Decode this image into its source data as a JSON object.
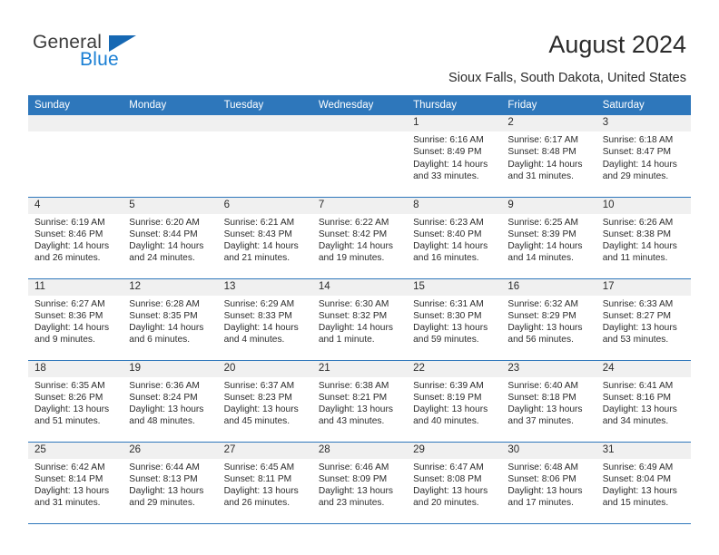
{
  "brand": {
    "name_part1": "General",
    "name_part2": "Blue",
    "logo_icon": "triangle-flag-icon",
    "accent_color": "#1a7fd4",
    "triangle_color": "#1668b3"
  },
  "header": {
    "title": "August 2024",
    "location": "Sioux Falls, South Dakota, United States"
  },
  "calendar": {
    "header_bg": "#2e77bb",
    "header_text_color": "#ffffff",
    "daynum_band_bg": "#f0f0f0",
    "weekday_headers": [
      "Sunday",
      "Monday",
      "Tuesday",
      "Wednesday",
      "Thursday",
      "Friday",
      "Saturday"
    ],
    "weeks": [
      [
        {
          "day": "",
          "sunrise": "",
          "sunset": "",
          "daylight_line1": "",
          "daylight_line2": ""
        },
        {
          "day": "",
          "sunrise": "",
          "sunset": "",
          "daylight_line1": "",
          "daylight_line2": ""
        },
        {
          "day": "",
          "sunrise": "",
          "sunset": "",
          "daylight_line1": "",
          "daylight_line2": ""
        },
        {
          "day": "",
          "sunrise": "",
          "sunset": "",
          "daylight_line1": "",
          "daylight_line2": ""
        },
        {
          "day": "1",
          "sunrise": "Sunrise: 6:16 AM",
          "sunset": "Sunset: 8:49 PM",
          "daylight_line1": "Daylight: 14 hours",
          "daylight_line2": "and 33 minutes."
        },
        {
          "day": "2",
          "sunrise": "Sunrise: 6:17 AM",
          "sunset": "Sunset: 8:48 PM",
          "daylight_line1": "Daylight: 14 hours",
          "daylight_line2": "and 31 minutes."
        },
        {
          "day": "3",
          "sunrise": "Sunrise: 6:18 AM",
          "sunset": "Sunset: 8:47 PM",
          "daylight_line1": "Daylight: 14 hours",
          "daylight_line2": "and 29 minutes."
        }
      ],
      [
        {
          "day": "4",
          "sunrise": "Sunrise: 6:19 AM",
          "sunset": "Sunset: 8:46 PM",
          "daylight_line1": "Daylight: 14 hours",
          "daylight_line2": "and 26 minutes."
        },
        {
          "day": "5",
          "sunrise": "Sunrise: 6:20 AM",
          "sunset": "Sunset: 8:44 PM",
          "daylight_line1": "Daylight: 14 hours",
          "daylight_line2": "and 24 minutes."
        },
        {
          "day": "6",
          "sunrise": "Sunrise: 6:21 AM",
          "sunset": "Sunset: 8:43 PM",
          "daylight_line1": "Daylight: 14 hours",
          "daylight_line2": "and 21 minutes."
        },
        {
          "day": "7",
          "sunrise": "Sunrise: 6:22 AM",
          "sunset": "Sunset: 8:42 PM",
          "daylight_line1": "Daylight: 14 hours",
          "daylight_line2": "and 19 minutes."
        },
        {
          "day": "8",
          "sunrise": "Sunrise: 6:23 AM",
          "sunset": "Sunset: 8:40 PM",
          "daylight_line1": "Daylight: 14 hours",
          "daylight_line2": "and 16 minutes."
        },
        {
          "day": "9",
          "sunrise": "Sunrise: 6:25 AM",
          "sunset": "Sunset: 8:39 PM",
          "daylight_line1": "Daylight: 14 hours",
          "daylight_line2": "and 14 minutes."
        },
        {
          "day": "10",
          "sunrise": "Sunrise: 6:26 AM",
          "sunset": "Sunset: 8:38 PM",
          "daylight_line1": "Daylight: 14 hours",
          "daylight_line2": "and 11 minutes."
        }
      ],
      [
        {
          "day": "11",
          "sunrise": "Sunrise: 6:27 AM",
          "sunset": "Sunset: 8:36 PM",
          "daylight_line1": "Daylight: 14 hours",
          "daylight_line2": "and 9 minutes."
        },
        {
          "day": "12",
          "sunrise": "Sunrise: 6:28 AM",
          "sunset": "Sunset: 8:35 PM",
          "daylight_line1": "Daylight: 14 hours",
          "daylight_line2": "and 6 minutes."
        },
        {
          "day": "13",
          "sunrise": "Sunrise: 6:29 AM",
          "sunset": "Sunset: 8:33 PM",
          "daylight_line1": "Daylight: 14 hours",
          "daylight_line2": "and 4 minutes."
        },
        {
          "day": "14",
          "sunrise": "Sunrise: 6:30 AM",
          "sunset": "Sunset: 8:32 PM",
          "daylight_line1": "Daylight: 14 hours",
          "daylight_line2": "and 1 minute."
        },
        {
          "day": "15",
          "sunrise": "Sunrise: 6:31 AM",
          "sunset": "Sunset: 8:30 PM",
          "daylight_line1": "Daylight: 13 hours",
          "daylight_line2": "and 59 minutes."
        },
        {
          "day": "16",
          "sunrise": "Sunrise: 6:32 AM",
          "sunset": "Sunset: 8:29 PM",
          "daylight_line1": "Daylight: 13 hours",
          "daylight_line2": "and 56 minutes."
        },
        {
          "day": "17",
          "sunrise": "Sunrise: 6:33 AM",
          "sunset": "Sunset: 8:27 PM",
          "daylight_line1": "Daylight: 13 hours",
          "daylight_line2": "and 53 minutes."
        }
      ],
      [
        {
          "day": "18",
          "sunrise": "Sunrise: 6:35 AM",
          "sunset": "Sunset: 8:26 PM",
          "daylight_line1": "Daylight: 13 hours",
          "daylight_line2": "and 51 minutes."
        },
        {
          "day": "19",
          "sunrise": "Sunrise: 6:36 AM",
          "sunset": "Sunset: 8:24 PM",
          "daylight_line1": "Daylight: 13 hours",
          "daylight_line2": "and 48 minutes."
        },
        {
          "day": "20",
          "sunrise": "Sunrise: 6:37 AM",
          "sunset": "Sunset: 8:23 PM",
          "daylight_line1": "Daylight: 13 hours",
          "daylight_line2": "and 45 minutes."
        },
        {
          "day": "21",
          "sunrise": "Sunrise: 6:38 AM",
          "sunset": "Sunset: 8:21 PM",
          "daylight_line1": "Daylight: 13 hours",
          "daylight_line2": "and 43 minutes."
        },
        {
          "day": "22",
          "sunrise": "Sunrise: 6:39 AM",
          "sunset": "Sunset: 8:19 PM",
          "daylight_line1": "Daylight: 13 hours",
          "daylight_line2": "and 40 minutes."
        },
        {
          "day": "23",
          "sunrise": "Sunrise: 6:40 AM",
          "sunset": "Sunset: 8:18 PM",
          "daylight_line1": "Daylight: 13 hours",
          "daylight_line2": "and 37 minutes."
        },
        {
          "day": "24",
          "sunrise": "Sunrise: 6:41 AM",
          "sunset": "Sunset: 8:16 PM",
          "daylight_line1": "Daylight: 13 hours",
          "daylight_line2": "and 34 minutes."
        }
      ],
      [
        {
          "day": "25",
          "sunrise": "Sunrise: 6:42 AM",
          "sunset": "Sunset: 8:14 PM",
          "daylight_line1": "Daylight: 13 hours",
          "daylight_line2": "and 31 minutes."
        },
        {
          "day": "26",
          "sunrise": "Sunrise: 6:44 AM",
          "sunset": "Sunset: 8:13 PM",
          "daylight_line1": "Daylight: 13 hours",
          "daylight_line2": "and 29 minutes."
        },
        {
          "day": "27",
          "sunrise": "Sunrise: 6:45 AM",
          "sunset": "Sunset: 8:11 PM",
          "daylight_line1": "Daylight: 13 hours",
          "daylight_line2": "and 26 minutes."
        },
        {
          "day": "28",
          "sunrise": "Sunrise: 6:46 AM",
          "sunset": "Sunset: 8:09 PM",
          "daylight_line1": "Daylight: 13 hours",
          "daylight_line2": "and 23 minutes."
        },
        {
          "day": "29",
          "sunrise": "Sunrise: 6:47 AM",
          "sunset": "Sunset: 8:08 PM",
          "daylight_line1": "Daylight: 13 hours",
          "daylight_line2": "and 20 minutes."
        },
        {
          "day": "30",
          "sunrise": "Sunrise: 6:48 AM",
          "sunset": "Sunset: 8:06 PM",
          "daylight_line1": "Daylight: 13 hours",
          "daylight_line2": "and 17 minutes."
        },
        {
          "day": "31",
          "sunrise": "Sunrise: 6:49 AM",
          "sunset": "Sunset: 8:04 PM",
          "daylight_line1": "Daylight: 13 hours",
          "daylight_line2": "and 15 minutes."
        }
      ]
    ]
  }
}
